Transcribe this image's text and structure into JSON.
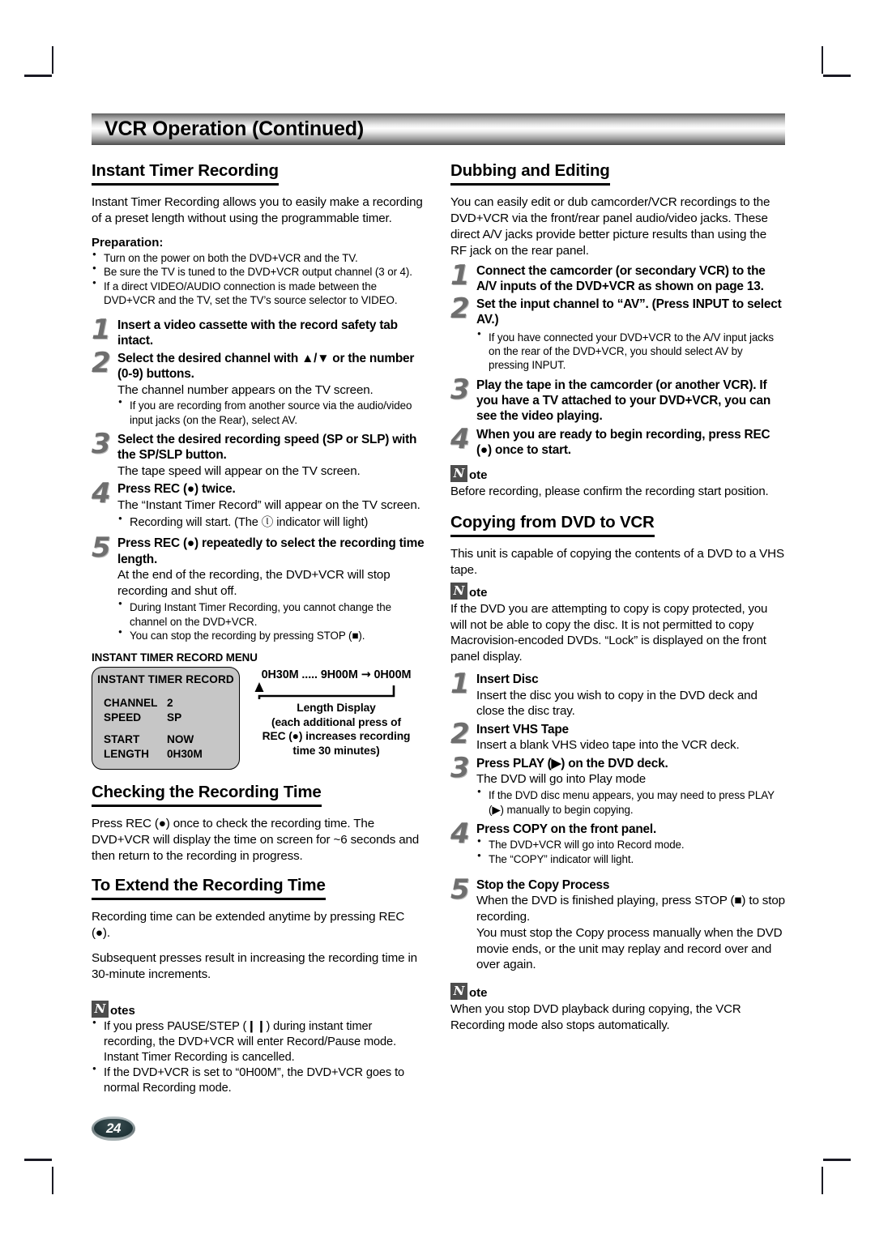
{
  "header": {
    "title": "VCR Operation (Continued)"
  },
  "page_number": "24",
  "left": {
    "instant_timer": {
      "heading": "Instant Timer Recording",
      "intro": "Instant Timer Recording allows you to easily make a recording of a preset length without using the programmable timer.",
      "preparation_title": "Preparation:",
      "preparation_bullets": [
        "Turn on the power on both the DVD+VCR and the TV.",
        "Be sure the TV is tuned to the DVD+VCR output channel (3 or 4).",
        "If a direct VIDEO/AUDIO connection is made between the DVD+VCR and the TV, set the TV’s source selector to VIDEO."
      ],
      "steps": [
        {
          "num": "1",
          "head": "Insert a video cassette with the record safety tab intact.",
          "detail": "",
          "bullets": []
        },
        {
          "num": "2",
          "head": "Select the desired channel with ▲/▼ or the number (0-9) buttons.",
          "detail": "The channel number appears on the TV screen.",
          "bullets": [
            "If you are recording from another source via the audio/video input jacks (on the Rear), select AV."
          ]
        },
        {
          "num": "3",
          "head": "Select the desired recording speed (SP or SLP) with the SP/SLP button.",
          "detail": "The tape speed will appear on the TV screen.",
          "bullets": []
        },
        {
          "num": "4",
          "head": "Press REC (●) twice.",
          "detail": "The “Instant Timer Record” will appear on the TV screen.",
          "bullets": [
            "Recording will start. (The ⓛ indicator will light)"
          ]
        },
        {
          "num": "5",
          "head": "Press REC (●) repeatedly to select the recording time length.",
          "detail": "At the end of the recording, the DVD+VCR will stop recording and shut off.",
          "bullets": [
            "During Instant Timer Recording, you cannot change the channel on the DVD+VCR.",
            "You can stop the recording by pressing STOP (■)."
          ]
        }
      ],
      "menu_label": "INSTANT TIMER RECORD MENU",
      "osd": {
        "title": "INSTANT TIMER RECORD",
        "rows": [
          {
            "key": "CHANNEL",
            "value": "2"
          },
          {
            "key": "SPEED",
            "value": "SP"
          },
          {
            "key": "START",
            "value": "NOW"
          },
          {
            "key": "LENGTH",
            "value": "0H30M"
          }
        ]
      },
      "length_figure": {
        "range_start": "0H30M",
        "dots": ".....",
        "range_end": "9H00M",
        "arrow": "→",
        "wrap": "0H00M",
        "caption_line1": "Length Display",
        "caption_line2": "(each additional press of",
        "caption_line3": "REC (●) increases recording",
        "caption_line4": "time 30 minutes)"
      }
    },
    "checking": {
      "heading": "Checking the Recording Time",
      "body": "Press REC (●) once to check the recording time. The DVD+VCR will display the time on screen for ~6 seconds and then return to the recording in progress."
    },
    "extend": {
      "heading": "To Extend the Recording Time",
      "body1": "Recording time can be extended anytime by pressing REC (●).",
      "body2": "Subsequent presses result in increasing the recording time in 30-minute increments."
    },
    "notes": {
      "icon_letter": "N",
      "word": "otes",
      "bullets": [
        "If you press PAUSE/STEP (❙❙) during instant timer recording, the DVD+VCR will enter Record/Pause mode. Instant Timer Recording is cancelled.",
        "If the DVD+VCR is set to “0H00M”, the DVD+VCR goes to normal Recording mode."
      ]
    }
  },
  "right": {
    "dubbing": {
      "heading": "Dubbing and Editing",
      "intro": "You can easily edit or dub camcorder/VCR recordings to the DVD+VCR via the front/rear panel audio/video jacks. These direct A/V jacks provide better picture results than using the RF jack on the rear panel.",
      "steps": [
        {
          "num": "1",
          "head": "Connect the camcorder (or secondary VCR) to the A/V inputs of the DVD+VCR as shown on page 13.",
          "detail": "",
          "bullets": []
        },
        {
          "num": "2",
          "head": "Set the input channel to “AV”. (Press INPUT to select AV.)",
          "detail": "",
          "bullets": [
            "If you have connected your DVD+VCR to the A/V input jacks on the rear of the DVD+VCR, you should select AV by pressing INPUT."
          ]
        },
        {
          "num": "3",
          "head": "Play the tape in the camcorder (or another VCR). If you have a TV attached to your DVD+VCR, you can see the video playing.",
          "detail": "",
          "bullets": []
        },
        {
          "num": "4",
          "head": "When you are ready to begin recording, press REC (●) once to start.",
          "detail": "",
          "bullets": []
        }
      ],
      "note": {
        "icon_letter": "N",
        "word": "ote",
        "body": "Before recording, please confirm the recording start position."
      }
    },
    "copying": {
      "heading": "Copying from DVD to VCR",
      "intro": "This unit is capable of copying the contents of a DVD to a VHS tape.",
      "note": {
        "icon_letter": "N",
        "word": "ote",
        "body": "If the DVD you are attempting to copy is copy protected, you will not be able to copy the disc. It is not permitted to copy Macrovision-encoded DVDs. “Lock” is displayed on the front panel display."
      },
      "steps": [
        {
          "num": "1",
          "head": "Insert Disc",
          "detail": "Insert the disc you wish to copy in the DVD deck and close the disc tray.",
          "bullets": []
        },
        {
          "num": "2",
          "head": "Insert VHS Tape",
          "detail": "Insert a blank VHS video tape into the VCR deck.",
          "bullets": []
        },
        {
          "num": "3",
          "head": "Press PLAY (▶) on the DVD deck.",
          "detail": "The DVD will go into Play mode",
          "bullets": [
            "If the DVD disc menu appears, you may need to press PLAY (▶) manually to begin copying."
          ]
        },
        {
          "num": "4",
          "head": "Press COPY on the front panel.",
          "detail": "",
          "bullets": [
            "The DVD+VCR will go into Record mode.",
            "The “COPY” indicator will light."
          ]
        },
        {
          "num": "5",
          "head": "Stop the Copy Process",
          "detail": "When the DVD is finished playing, press STOP (■) to stop recording.\nYou must stop the Copy process manually when the DVD movie ends, or the unit may replay and record over and over again.",
          "bullets": []
        }
      ],
      "note2": {
        "icon_letter": "N",
        "word": "ote",
        "body": "When you stop DVD playback during copying, the VCR Recording mode also stops automatically."
      }
    }
  }
}
